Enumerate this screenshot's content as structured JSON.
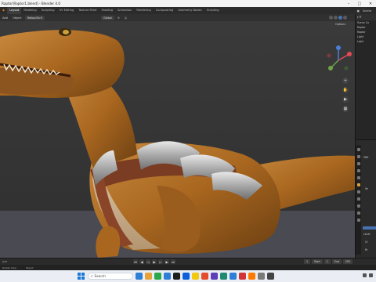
{
  "window": {
    "title": "Raptor\\Raptor1.blend] - Blender 4.0",
    "controls": [
      "–",
      "□",
      "✕"
    ]
  },
  "topbar": {
    "tabs": [
      "Layout",
      "Modeling",
      "Sculpting",
      "UV Editing",
      "Texture Paint",
      "Shading",
      "Animation",
      "Rendering",
      "Compositing",
      "Geometry Nodes",
      "Scripting"
    ],
    "active_tab": "Layout",
    "scene_label": "Scene"
  },
  "viewport_header": {
    "menus": [
      "Add",
      "Object"
    ],
    "mode": "Object",
    "selection": "RetopoTurtl",
    "transform": "Global",
    "options_label": "Options"
  },
  "outliner": {
    "rows": [
      "Scene Co",
      "Raptor",
      "Raptor",
      "Light",
      "Light"
    ]
  },
  "properties": {
    "labels": [
      "ENE",
      "Ve",
      "Level",
      "Ct",
      "Rr"
    ]
  },
  "timeline": {
    "current_frame": "1",
    "start_label": "Start",
    "start": "1",
    "end_label": "End",
    "end": "250",
    "controls": [
      "⏮",
      "◀",
      "◁",
      "▶",
      "▷",
      "▶",
      "⏭"
    ]
  },
  "status": {
    "items": [
      "Rotate View",
      "Object"
    ]
  },
  "taskbar": {
    "search_placeholder": "Search",
    "app_icon_colors": [
      "#2f7fd6",
      "#e8a23a",
      "#2aa84a",
      "#2f7fd6",
      "#1e1e1e",
      "#0b5fd8",
      "#f2c811",
      "#e44c2c",
      "#5b3fb8",
      "#1f8a70",
      "#2f7fd6",
      "#d13438",
      "#ff7a00",
      "#7a7a7a",
      "#444444"
    ]
  }
}
